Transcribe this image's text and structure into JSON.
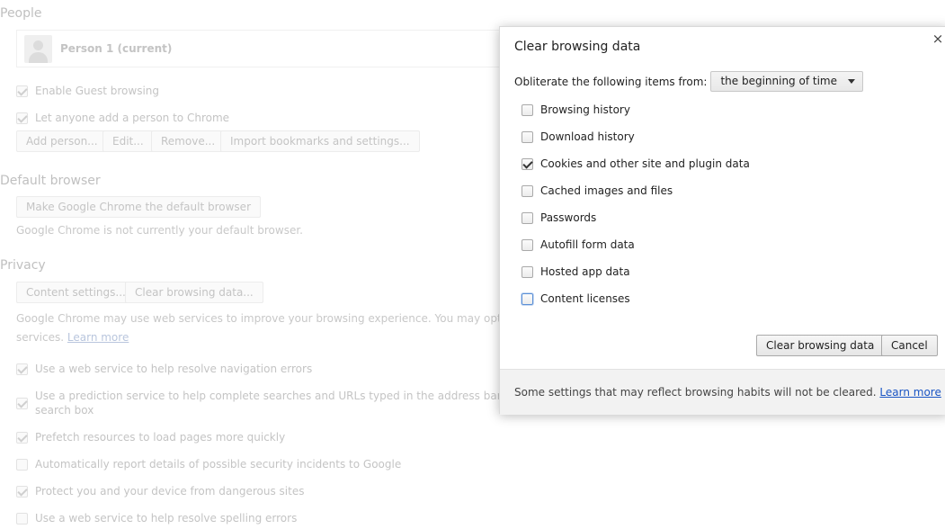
{
  "background": {
    "people": {
      "title": "People",
      "person_name": "Person 1 (current)",
      "enable_guest": "Enable Guest browsing",
      "anyone_add": "Let anyone add a person to Chrome",
      "buttons": [
        "Add person...",
        "Edit...",
        "Remove...",
        "Import bookmarks and settings..."
      ]
    },
    "default_browser": {
      "title": "Default browser",
      "make_default_button": "Make Google Chrome the default browser",
      "status": "Google Chrome is not currently your default browser."
    },
    "privacy": {
      "title": "Privacy",
      "content_settings_button": "Content settings...",
      "clear_data_button": "Clear browsing data...",
      "description_line1": "Google Chrome may use web services to improve your browsing experience. You may optionally disa",
      "description_line2": "services.",
      "learn_more": "Learn more",
      "options": [
        {
          "label": "Use a web service to help resolve navigation errors",
          "checked": true
        },
        {
          "label": "Use a prediction service to help complete searches and URLs typed in the address bar or the app l",
          "label2": "search box",
          "checked": true
        },
        {
          "label": "Prefetch resources to load pages more quickly",
          "checked": true
        },
        {
          "label": "Automatically report details of possible security incidents to Google",
          "checked": false
        },
        {
          "label": "Protect you and your device from dangerous sites",
          "checked": true
        },
        {
          "label": "Use a web service to help resolve spelling errors",
          "checked": false
        }
      ]
    }
  },
  "dialog": {
    "title": "Clear browsing data",
    "close_glyph": "×",
    "obliterate_label": "Obliterate the following items from:",
    "time_range": "the beginning of time",
    "items": [
      {
        "label": "Browsing history",
        "checked": false
      },
      {
        "label": "Download history",
        "checked": false
      },
      {
        "label": "Cookies and other site and plugin data",
        "checked": true
      },
      {
        "label": "Cached images and files",
        "checked": false
      },
      {
        "label": "Passwords",
        "checked": false
      },
      {
        "label": "Autofill form data",
        "checked": false
      },
      {
        "label": "Hosted app data",
        "checked": false
      },
      {
        "label": "Content licenses",
        "checked": false,
        "focused": true
      }
    ],
    "clear_button": "Clear browsing data",
    "cancel_button": "Cancel",
    "footer_text": "Some settings that may reflect browsing habits will not be cleared.",
    "footer_link": "Learn more"
  }
}
